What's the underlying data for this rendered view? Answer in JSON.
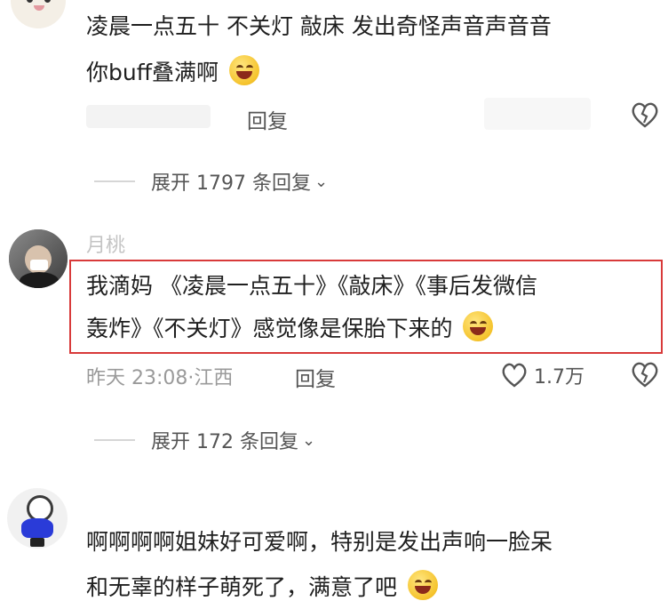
{
  "comments": [
    {
      "text_line1": "凌晨一点五十 不关灯 敲床 发出奇怪声音声音音",
      "text_line2": "你buff叠满啊",
      "reply_label": "回复",
      "expand_label": "展开 1797 条回复"
    },
    {
      "username": "月桃",
      "text_line1": "我滴妈 《凌晨一点五十》《敲床》《事后发微信",
      "text_line2": "轰炸》《不关灯》感觉像是保胎下来的",
      "time": "昨天 23:08",
      "location": "江西",
      "meta_sep": "·",
      "reply_label": "回复",
      "like_count": "1.7万",
      "expand_label": "展开 172 条回复"
    },
    {
      "text_line1": "啊啊啊啊姐妹好可爱啊，特别是发出声响一脸呆",
      "text_line2": "和无辜的样子萌死了，满意了吧"
    }
  ],
  "colors": {
    "highlight_border": "#d83a3a",
    "text": "#1f1f1f",
    "muted": "#9a9a9a"
  },
  "icons": {
    "heart": "heart-outline-icon",
    "dislike": "broken-heart-icon",
    "chevron": "chevron-down-icon",
    "emoji": "grin-emoji-icon"
  }
}
